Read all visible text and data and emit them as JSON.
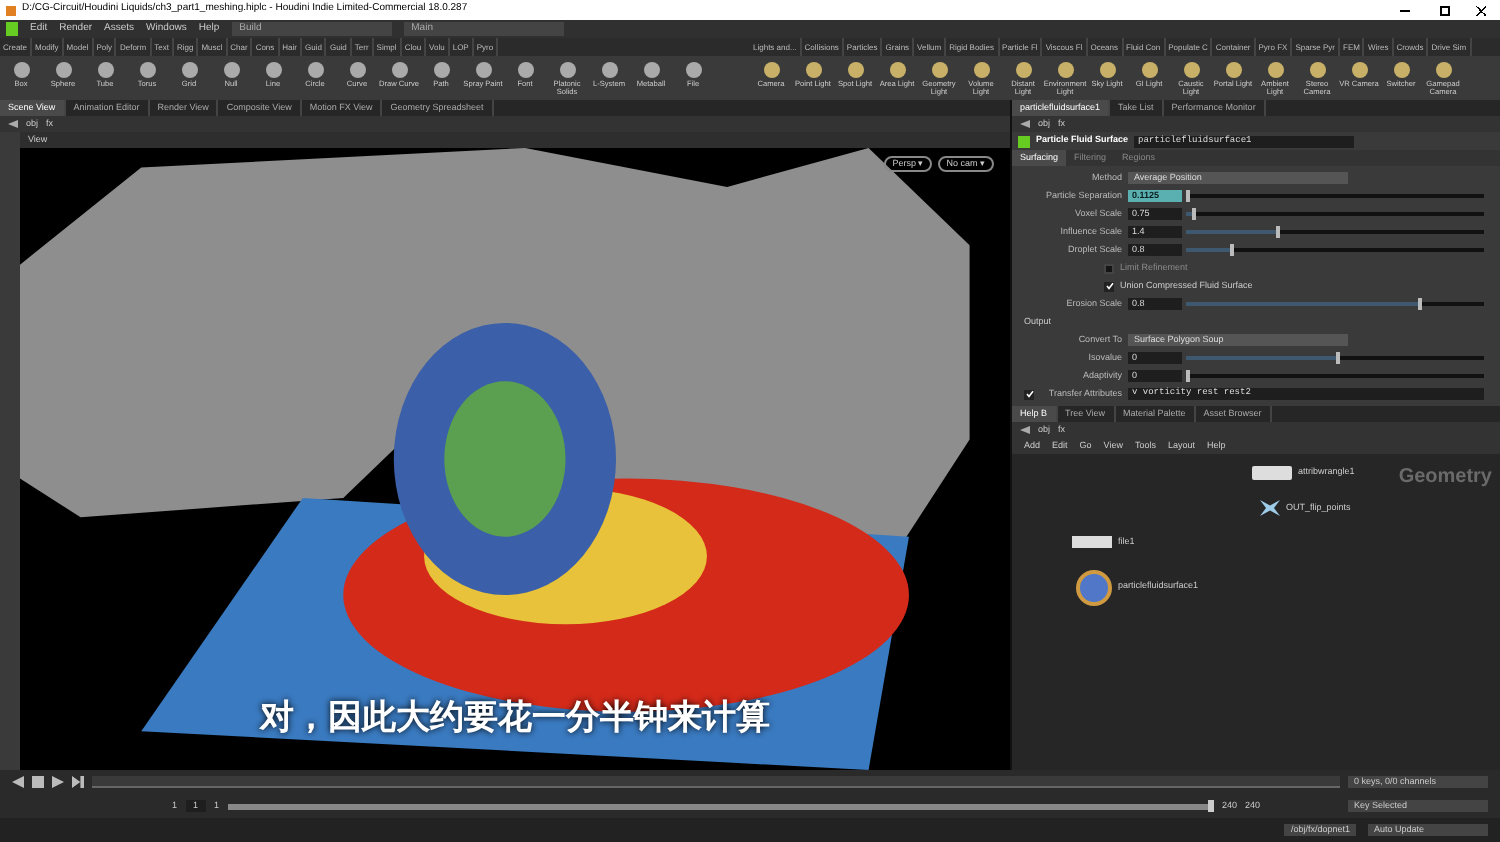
{
  "window": {
    "title": "D:/CG-Circuit/Houdini Liquids/ch3_part1_meshing.hiplc - Houdini Indie Limited-Commercial 18.0.287"
  },
  "menu": [
    "Edit",
    "Render",
    "Assets",
    "Windows",
    "Help"
  ],
  "desktops": [
    "Build",
    "Main"
  ],
  "shelf_left": {
    "tabs": [
      "Create",
      "Modify",
      "Model",
      "Poly",
      "Deform",
      "Text",
      "Rigg",
      "Muscl",
      "Char",
      "Cons",
      "Hair",
      "Guid",
      "Guid",
      "Terr",
      "Simpl",
      "Clou",
      "Volu",
      "LOP",
      "Pyro"
    ],
    "tools": [
      "Box",
      "Sphere",
      "Tube",
      "Torus",
      "Grid",
      "Null",
      "Line",
      "Circle",
      "Curve",
      "Draw Curve",
      "Path",
      "Spray Paint",
      "Font",
      "Platonic Solids",
      "L-System",
      "Metaball",
      "File"
    ]
  },
  "shelf_right": {
    "tabs": [
      "Lights and...",
      "Collisions",
      "Particles",
      "Grains",
      "Vellum",
      "Rigid Bodies",
      "Particle Fl",
      "Viscous Fl",
      "Oceans",
      "Fluid Con",
      "Populate C",
      "Container",
      "Pyro FX",
      "Sparse Pyr",
      "FEM",
      "Wires",
      "Crowds",
      "Drive Sim"
    ],
    "tools": [
      "Camera",
      "Point Light",
      "Spot Light",
      "Area Light",
      "Geometry Light",
      "Volume Light",
      "Distant Light",
      "Environment Light",
      "Sky Light",
      "GI Light",
      "Caustic Light",
      "Portal Light",
      "Ambient Light",
      "Stereo Camera",
      "VR Camera",
      "Switcher",
      "Gamepad Camera"
    ]
  },
  "left_pane": {
    "tabs": [
      {
        "label": "Scene View",
        "selected": true
      },
      {
        "label": "Animation Editor",
        "selected": false
      },
      {
        "label": "Render View",
        "selected": false
      },
      {
        "label": "Composite View",
        "selected": false
      },
      {
        "label": "Motion FX View",
        "selected": false
      },
      {
        "label": "Geometry Spreadsheet",
        "selected": false
      }
    ],
    "path": [
      "obj",
      "fx"
    ],
    "view_label": "View",
    "camera_buttons": [
      "Persp ▾",
      "No cam ▾"
    ]
  },
  "right_pane": {
    "tabs": [
      {
        "label": "particlefluidsurface1",
        "selected": true
      },
      {
        "label": "Take List",
        "selected": false
      },
      {
        "label": "Performance Monitor",
        "selected": false
      }
    ],
    "path": [
      "obj",
      "fx"
    ],
    "node_type": "Particle Fluid Surface",
    "node_name": "particlefluidsurface1",
    "param_tabs": [
      {
        "label": "Surfacing",
        "selected": true
      },
      {
        "label": "Filtering",
        "selected": false
      },
      {
        "label": "Regions",
        "selected": false
      }
    ],
    "params": [
      {
        "kind": "menu",
        "label": "Method",
        "value": "Average Position"
      },
      {
        "kind": "slider",
        "label": "Particle Separation",
        "value": "0.1125",
        "level": 0.0,
        "highlighted": true
      },
      {
        "kind": "slider",
        "label": "Voxel Scale",
        "value": "0.75",
        "level": 0.02,
        "highlighted": false
      },
      {
        "kind": "slider",
        "label": "Influence Scale",
        "value": "1.4",
        "level": 0.3,
        "highlighted": false
      },
      {
        "kind": "slider",
        "label": "Droplet Scale",
        "value": "0.8",
        "level": 0.15,
        "highlighted": false
      },
      {
        "kind": "toggle",
        "label": "Limit Refinement",
        "checked": false,
        "disabled": true
      },
      {
        "kind": "toggle",
        "label": "Union Compressed Fluid Surface",
        "checked": true,
        "disabled": false
      },
      {
        "kind": "slider",
        "label": "Erosion Scale",
        "value": "0.8",
        "level": 0.78,
        "highlighted": false
      },
      {
        "kind": "section",
        "label": "Output"
      },
      {
        "kind": "menu",
        "label": "Convert To",
        "value": "Surface Polygon Soup"
      },
      {
        "kind": "slider",
        "label": "Isovalue",
        "value": "0",
        "level": 0.5,
        "highlighted": false
      },
      {
        "kind": "slider",
        "label": "Adaptivity",
        "value": "0",
        "level": 0.0,
        "highlighted": false
      },
      {
        "kind": "text",
        "label": "Transfer Attributes",
        "value": "v vorticity rest rest2",
        "checked": true
      }
    ]
  },
  "network": {
    "tabs": [
      {
        "label": "Help B",
        "selected": true
      },
      {
        "label": "Tree View",
        "selected": false
      },
      {
        "label": "Material Palette",
        "selected": false
      },
      {
        "label": "Asset Browser",
        "selected": false
      }
    ],
    "path": [
      "obj",
      "fx"
    ],
    "menu": [
      "Add",
      "Edit",
      "Go",
      "View",
      "Tools",
      "Layout",
      "Help"
    ],
    "context_label": "Geometry",
    "nodes": [
      {
        "kind": "wrangle",
        "label": "attribwrangle1"
      },
      {
        "kind": "null",
        "label": "OUT_flip_points"
      },
      {
        "kind": "file",
        "label": "file1"
      },
      {
        "kind": "surface",
        "label": "particlefluidsurface1"
      }
    ]
  },
  "timeline": {
    "range_slider": {
      "level": 1
    },
    "start": "1",
    "current": "1",
    "range_start": "1",
    "range_end": "240",
    "end": "240",
    "keys": "0 keys, 0/0 channels",
    "key_mode": "Key Selected",
    "status_path": "/obj/fx/dopnet1",
    "update_mode": "Auto Update"
  },
  "subtitle": "对，因此大约要花一分半钟来计算"
}
